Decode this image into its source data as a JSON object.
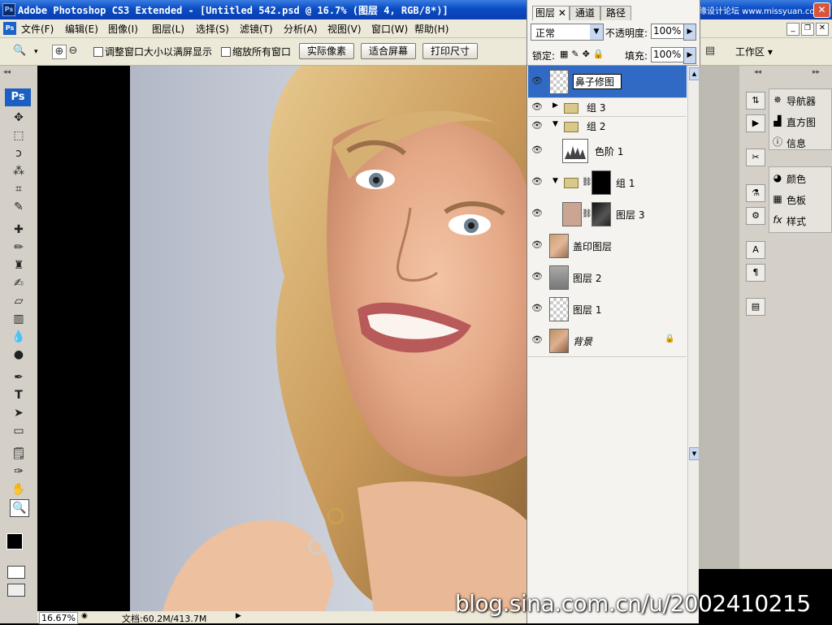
{
  "window": {
    "title": "Adobe Photoshop CS3 Extended - [Untitled 542.psd @ 16.7% (图层 4, RGB/8*)]",
    "app_icon": "Ps"
  },
  "menu": [
    "文件(F)",
    "编辑(E)",
    "图像(I)",
    "图层(L)",
    "选择(S)",
    "滤镜(T)",
    "分析(A)",
    "视图(V)",
    "窗口(W)",
    "帮助(H)"
  ],
  "options": {
    "resize_windows_label": "调整窗口大小以满屏显示",
    "zoom_all_label": "缩放所有窗口",
    "actual_pixels": "实际像素",
    "fit_screen": "适合屏幕",
    "print_size": "打印尺寸",
    "workspace": "工作区 ▾"
  },
  "toolbox": {
    "logo": "Ps",
    "tools": [
      "move",
      "marquee",
      "lasso",
      "magic-wand",
      "crop",
      "slice",
      "healing",
      "brush",
      "stamp",
      "history-brush",
      "eraser",
      "gradient",
      "blur",
      "dodge",
      "pen",
      "type",
      "path-select",
      "shape",
      "notes",
      "eyedropper",
      "hand",
      "zoom"
    ]
  },
  "layers_panel": {
    "tabs": [
      "图层",
      "通道",
      "路径"
    ],
    "blend_mode": "正常",
    "opacity_label": "不透明度:",
    "opacity": "100%",
    "lock_label": "锁定:",
    "fill_label": "填充:",
    "fill": "100%",
    "layers": [
      {
        "name": "鼻子修图",
        "kind": "transparent",
        "selected": true
      },
      {
        "name": "组 3",
        "kind": "group-collapsed"
      },
      {
        "name": "组 2",
        "kind": "group-expanded"
      },
      {
        "name": "色阶 1",
        "kind": "adjustment"
      },
      {
        "name": "组 1",
        "kind": "group-masked"
      },
      {
        "name": "图层 3",
        "kind": "fill-masked"
      },
      {
        "name": "盖印图层",
        "kind": "photo"
      },
      {
        "name": "图层 2",
        "kind": "gray"
      },
      {
        "name": "图层 1",
        "kind": "transparent"
      },
      {
        "name": "背景",
        "kind": "background"
      }
    ]
  },
  "panels": {
    "group1": [
      "导航器",
      "直方图",
      "信息"
    ],
    "group2": [
      "颜色",
      "色板",
      "样式"
    ]
  },
  "status": {
    "zoom": "16.67%",
    "doc": "文档:60.2M/413.7M"
  },
  "watermark": "blog.sina.com.cn/u/2002410215",
  "watermark_top": "思缘设计论坛 www.missyuan.com",
  "colors": {
    "title_blue": "#0a4cc4",
    "selected_layer": "#316ac5",
    "chrome": "#ece9d8"
  }
}
